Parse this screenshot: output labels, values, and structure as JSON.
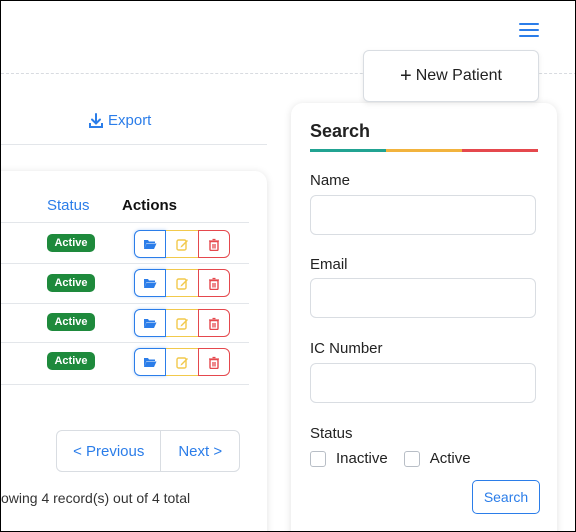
{
  "header": {
    "menu_icon": "hamburger-icon",
    "new_patient_label": "New Patient",
    "new_patient_icon": "plus-icon"
  },
  "toolbar": {
    "export_label": "Export",
    "export_icon": "download-icon"
  },
  "table": {
    "columns": [
      "Status",
      "Actions"
    ],
    "rows": [
      {
        "status": "Active"
      },
      {
        "status": "Active"
      },
      {
        "status": "Active"
      },
      {
        "status": "Active"
      }
    ],
    "action_icons": [
      "folder-open-icon",
      "edit-icon",
      "trash-icon"
    ]
  },
  "pagination": {
    "prev_label": "< Previous",
    "next_label": "Next >",
    "summary": "owing 4 record(s) out of 4 total"
  },
  "search": {
    "title": "Search",
    "name_label": "Name",
    "email_label": "Email",
    "ic_label": "IC Number",
    "status_label": "Status",
    "status_options": [
      "Inactive",
      "Active"
    ],
    "button_label": "Search"
  },
  "colors": {
    "accent": "#2b7de9",
    "success": "#1e8a3c",
    "warning": "#f2c94c",
    "danger": "#e5484d",
    "rule": [
      "#21a392",
      "#f2b33d",
      "#e5484d"
    ]
  }
}
